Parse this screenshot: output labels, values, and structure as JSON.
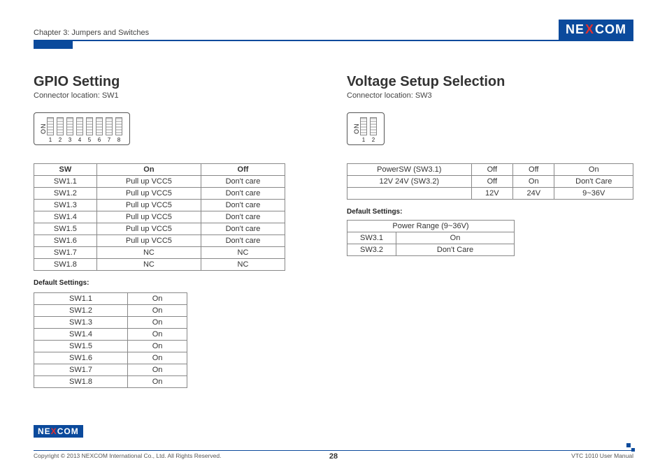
{
  "header": {
    "chapter": "Chapter 3: Jumpers and Switches",
    "brand_pre": "NE",
    "brand_x": "X",
    "brand_post": "COM"
  },
  "gpio": {
    "title": "GPIO Setting",
    "subtitle": "Connector location: SW1",
    "table_head": {
      "c1": "SW",
      "c2": "On",
      "c3": "Off"
    },
    "rows": [
      {
        "sw": "SW1.1",
        "on": "Pull up VCC5",
        "off": "Don't care"
      },
      {
        "sw": "SW1.2",
        "on": "Pull up VCC5",
        "off": "Don't care"
      },
      {
        "sw": "SW1.3",
        "on": "Pull up VCC5",
        "off": "Don't care"
      },
      {
        "sw": "SW1.4",
        "on": "Pull up VCC5",
        "off": "Don't care"
      },
      {
        "sw": "SW1.5",
        "on": "Pull up VCC5",
        "off": "Don't care"
      },
      {
        "sw": "SW1.6",
        "on": "Pull up VCC5",
        "off": "Don't care"
      },
      {
        "sw": "SW1.7",
        "on": "NC",
        "off": "NC"
      },
      {
        "sw": "SW1.8",
        "on": "NC",
        "off": "NC"
      }
    ],
    "default_label": "Default Settings:",
    "defaults": [
      {
        "sw": "SW1.1",
        "v": "On"
      },
      {
        "sw": "SW1.2",
        "v": "On"
      },
      {
        "sw": "SW1.3",
        "v": "On"
      },
      {
        "sw": "SW1.4",
        "v": "On"
      },
      {
        "sw": "SW1.5",
        "v": "On"
      },
      {
        "sw": "SW1.6",
        "v": "On"
      },
      {
        "sw": "SW1.7",
        "v": "On"
      },
      {
        "sw": "SW1.8",
        "v": "On"
      }
    ],
    "dip_count": 8,
    "dip_on_label": "ON"
  },
  "voltage": {
    "title": "Voltage Setup Selection",
    "subtitle": "Connector location: SW3",
    "dip_count": 2,
    "dip_on_label": "ON",
    "rows": [
      {
        "c1": "PowerSW (SW3.1)",
        "c2": "Off",
        "c3": "Off",
        "c4": "On"
      },
      {
        "c1": "12V 24V (SW3.2)",
        "c2": "Off",
        "c3": "On",
        "c4": "Don't Care"
      },
      {
        "c1": "",
        "c2": "12V",
        "c3": "24V",
        "c4": "9~36V"
      }
    ],
    "default_label": "Default Settings:",
    "def_header": "Power Range (9~36V)",
    "defaults": [
      {
        "sw": "SW3.1",
        "v": "On"
      },
      {
        "sw": "SW3.2",
        "v": "Don't Care"
      }
    ]
  },
  "footer": {
    "copyright": "Copyright © 2013 NEXCOM International Co., Ltd. All Rights Reserved.",
    "page": "28",
    "manual": "VTC 1010 User Manual"
  }
}
